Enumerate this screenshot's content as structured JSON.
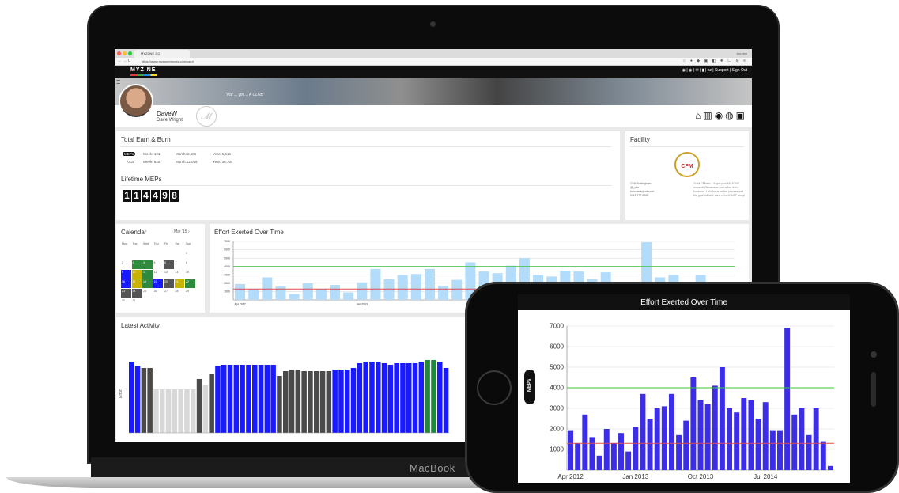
{
  "browser": {
    "tab_title": "MYZONE 2.0",
    "user": "Andrew",
    "url": "https://www.myzonemoves.com/user/"
  },
  "site": {
    "logo": "MYZ NE",
    "top_links": "| Support | Sign Out",
    "banner_text": "\"Not ... ym ... A CLUB\"",
    "profile": {
      "username": "DaveW",
      "full_name": "Dave Wright"
    },
    "nav_icons": [
      "home-icon",
      "stats-icon",
      "myzone-icon",
      "globe-icon",
      "scale-icon"
    ]
  },
  "earn_burn": {
    "title": "Total Earn & Burn",
    "rows": [
      {
        "label": "",
        "week": "Week: 121",
        "month": "Month: 2,185",
        "year": "Year: 6,616"
      },
      {
        "label": "KCal",
        "week": "Week: 825",
        "month": "Month:12,015",
        "year": "Year: 36,754"
      }
    ],
    "lifetime_title": "Lifetime MEPs",
    "lifetime_digits": [
      "1",
      "1",
      "4",
      "4",
      "9",
      "8"
    ]
  },
  "facility": {
    "title": "Facility",
    "logo_text": "CFM",
    "info": [
      "CFM Nottingham",
      "@_cfm",
      "hcooneuk@cfm.net",
      "0115 777 2222"
    ],
    "message": "To all CFMers... Enjoy your MYZONE account! Remember your effort is our business. Let's focus on the process and the goal will take care of itself! MEP away!"
  },
  "calendar": {
    "title": "Calendar",
    "month": "Mar '15",
    "weekdays": [
      "Mon",
      "Tue",
      "Wed",
      "Thu",
      "Fri",
      "Sat",
      "Sun"
    ],
    "days": [
      "",
      "",
      "",
      "",
      "",
      "",
      "1",
      "2",
      "3",
      "4",
      "5",
      "6",
      "7",
      "8",
      "9",
      "10",
      "11",
      "12",
      "13",
      "14",
      "15",
      "16",
      "17",
      "18",
      "19",
      "20",
      "21",
      "22",
      "23",
      "24",
      "25",
      "26",
      "27",
      "28",
      "29",
      "30",
      "31"
    ]
  },
  "laptop_chart": {
    "title": "Effort Exerted Over Time",
    "y_ticks": [
      "7000",
      "6000",
      "5000",
      "4000",
      "3000",
      "2000",
      "1000"
    ],
    "values": [
      1900,
      1300,
      2700,
      1600,
      700,
      2000,
      1300,
      1800,
      900,
      2100,
      3700,
      2500,
      3000,
      3100,
      3700,
      1700,
      2400,
      4500,
      3400,
      3200,
      4100,
      5000,
      3000,
      2800,
      3500,
      3400,
      2500,
      3300,
      1900,
      1900,
      6900,
      2700,
      3000,
      1700,
      3000,
      1400,
      200
    ]
  },
  "latest_activity": {
    "title": "Latest Activity",
    "y_label": "Effort",
    "bars": [
      {
        "h": 0.9,
        "c": "#1a1aff"
      },
      {
        "h": 0.85,
        "c": "#1a1aff"
      },
      {
        "h": 0.82,
        "c": "#4a4a4a"
      },
      {
        "h": 0.82,
        "c": "#4a4a4a"
      },
      {
        "h": 0.55,
        "c": "#d8d8d8"
      },
      {
        "h": 0.55,
        "c": "#d8d8d8"
      },
      {
        "h": 0.55,
        "c": "#d8d8d8"
      },
      {
        "h": 0.55,
        "c": "#d8d8d8"
      },
      {
        "h": 0.55,
        "c": "#d8d8d8"
      },
      {
        "h": 0.55,
        "c": "#d8d8d8"
      },
      {
        "h": 0.55,
        "c": "#d8d8d8"
      },
      {
        "h": 0.68,
        "c": "#4a4a4a"
      },
      {
        "h": 0.6,
        "c": "#d8d8d8"
      },
      {
        "h": 0.75,
        "c": "#4a4a4a"
      },
      {
        "h": 0.85,
        "c": "#1a1aff"
      },
      {
        "h": 0.86,
        "c": "#1a1aff"
      },
      {
        "h": 0.86,
        "c": "#1a1aff"
      },
      {
        "h": 0.86,
        "c": "#1a1aff"
      },
      {
        "h": 0.86,
        "c": "#1a1aff"
      },
      {
        "h": 0.86,
        "c": "#1a1aff"
      },
      {
        "h": 0.86,
        "c": "#1a1aff"
      },
      {
        "h": 0.86,
        "c": "#1a1aff"
      },
      {
        "h": 0.86,
        "c": "#1a1aff"
      },
      {
        "h": 0.86,
        "c": "#1a1aff"
      },
      {
        "h": 0.72,
        "c": "#4a4a4a"
      },
      {
        "h": 0.78,
        "c": "#4a4a4a"
      },
      {
        "h": 0.8,
        "c": "#4a4a4a"
      },
      {
        "h": 0.8,
        "c": "#4a4a4a"
      },
      {
        "h": 0.78,
        "c": "#4a4a4a"
      },
      {
        "h": 0.78,
        "c": "#4a4a4a"
      },
      {
        "h": 0.78,
        "c": "#4a4a4a"
      },
      {
        "h": 0.78,
        "c": "#4a4a4a"
      },
      {
        "h": 0.78,
        "c": "#4a4a4a"
      },
      {
        "h": 0.8,
        "c": "#1a1aff"
      },
      {
        "h": 0.8,
        "c": "#1a1aff"
      },
      {
        "h": 0.8,
        "c": "#1a1aff"
      },
      {
        "h": 0.82,
        "c": "#1a1aff"
      },
      {
        "h": 0.88,
        "c": "#1a1aff"
      },
      {
        "h": 0.9,
        "c": "#1a1aff"
      },
      {
        "h": 0.9,
        "c": "#1a1aff"
      },
      {
        "h": 0.9,
        "c": "#1a1aff"
      },
      {
        "h": 0.88,
        "c": "#1a1aff"
      },
      {
        "h": 0.86,
        "c": "#1a1aff"
      },
      {
        "h": 0.88,
        "c": "#1a1aff"
      },
      {
        "h": 0.88,
        "c": "#1a1aff"
      },
      {
        "h": 0.88,
        "c": "#1a1aff"
      },
      {
        "h": 0.88,
        "c": "#1a1aff"
      },
      {
        "h": 0.9,
        "c": "#1a1aff"
      },
      {
        "h": 0.92,
        "c": "#1f8a3a"
      },
      {
        "h": 0.92,
        "c": "#1f8a3a"
      },
      {
        "h": 0.9,
        "c": "#1a1aff"
      },
      {
        "h": 0.82,
        "c": "#1a1aff"
      }
    ]
  },
  "phone_chart": {
    "title": "Effort Exerted Over Time",
    "y_axis_badge": "MEPs",
    "x_labels": [
      "Apr 2012",
      "Jan 2013",
      "Oct 2013",
      "Jul 2014"
    ],
    "ylim": [
      0,
      7000
    ]
  },
  "chart_data": {
    "type": "bar",
    "title": "Effort Exerted Over Time",
    "ylabel": "MEPs",
    "ylim": [
      0,
      7000
    ],
    "y_ticks": [
      1000,
      2000,
      3000,
      4000,
      5000,
      6000,
      7000
    ],
    "x_tick_labels": [
      "Apr 2012",
      "Jan 2013",
      "Oct 2013",
      "Jul 2014"
    ],
    "x_tick_indices": [
      0,
      9,
      18,
      27
    ],
    "reference_lines": [
      {
        "value": 4000,
        "color": "#3cc23c"
      },
      {
        "value": 1300,
        "color": "#e04a4a"
      }
    ],
    "values": [
      1900,
      1300,
      2700,
      1600,
      700,
      2000,
      1300,
      1800,
      900,
      2100,
      3700,
      2500,
      3000,
      3100,
      3700,
      1700,
      2400,
      4500,
      3400,
      3200,
      4100,
      5000,
      3000,
      2800,
      3500,
      3400,
      2500,
      3300,
      1900,
      1900,
      6900,
      2700,
      3000,
      1700,
      3000,
      1400,
      200
    ],
    "bar_color": "#3b2ee6",
    "grid": true
  }
}
